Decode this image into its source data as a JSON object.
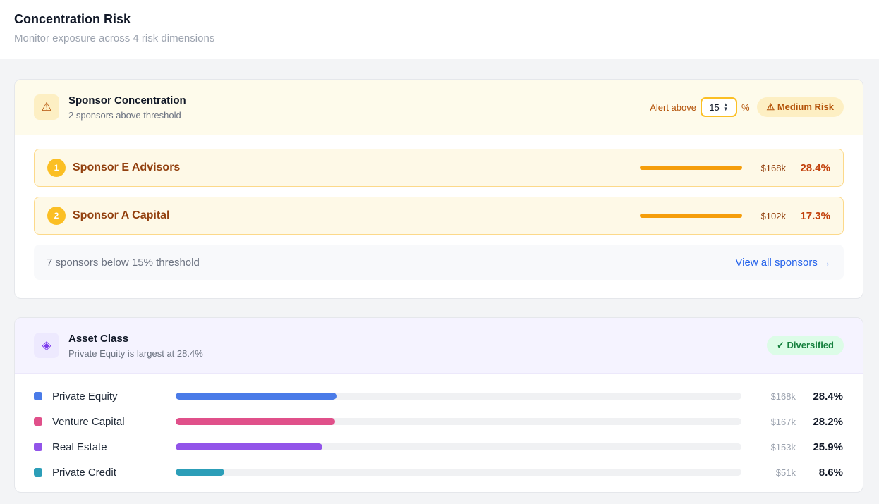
{
  "header": {
    "title": "Concentration Risk",
    "subtitle": "Monitor exposure across 4 risk dimensions"
  },
  "sponsor_card": {
    "title": "Sponsor Concentration",
    "subtitle": "2 sponsors above threshold",
    "icon": "warning-icon",
    "alert_label": "Alert above",
    "threshold_value": "15",
    "pct_sign": "%",
    "badge": "⚠ Medium Risk",
    "rows": [
      {
        "rank": "1",
        "name": "Sponsor E Advisors",
        "amount": "$168k",
        "pct": "28.4%"
      },
      {
        "rank": "2",
        "name": "Sponsor A Capital",
        "amount": "$102k",
        "pct": "17.3%"
      }
    ],
    "below_text": "7 sponsors below 15% threshold",
    "view_link": "View all sponsors →"
  },
  "asset_card": {
    "title": "Asset Class",
    "subtitle": "Private Equity is largest at 28.4%",
    "icon": "diamond-icon",
    "badge": "✓ Diversified",
    "rows": [
      {
        "name": "Private Equity",
        "amount": "$168k",
        "pct": "28.4%",
        "share": 28.4,
        "color": "#4a7be8"
      },
      {
        "name": "Venture Capital",
        "amount": "$167k",
        "pct": "28.2%",
        "share": 28.2,
        "color": "#e0508a"
      },
      {
        "name": "Real Estate",
        "amount": "$153k",
        "pct": "25.9%",
        "share": 25.9,
        "color": "#9254e9"
      },
      {
        "name": "Private Credit",
        "amount": "$51k",
        "pct": "8.6%",
        "share": 8.6,
        "color": "#2c9eb8"
      }
    ]
  },
  "colors": {
    "warning_accent": "#f59e0b",
    "link": "#2563eb",
    "success": "#15803d"
  }
}
